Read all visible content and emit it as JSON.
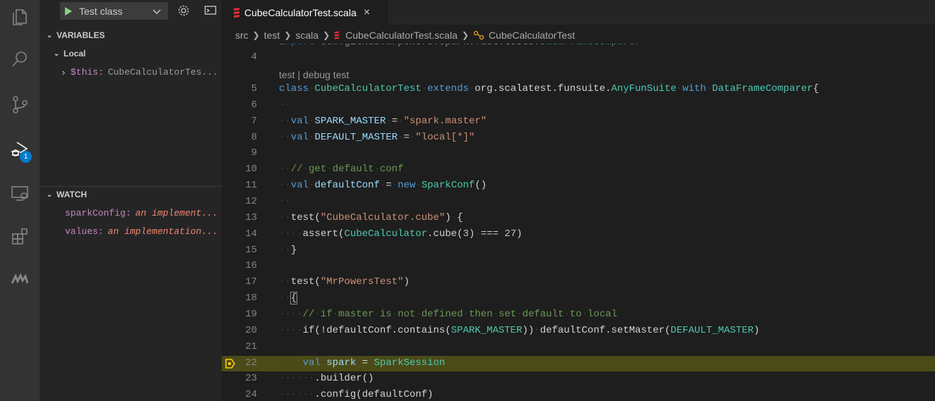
{
  "debug": {
    "config_label": "Test class"
  },
  "variables": {
    "header": "VARIABLES",
    "scope_label": "Local",
    "items": [
      {
        "name": "$this:",
        "value": "CubeCalculatorTes..."
      }
    ]
  },
  "watch": {
    "header": "WATCH",
    "items": [
      {
        "name": "sparkConfig:",
        "value": "an implement..."
      },
      {
        "name": "values:",
        "value": "an implementation..."
      }
    ]
  },
  "activity": {
    "debug_badge": "1"
  },
  "tab": {
    "filename": "CubeCalculatorTest.scala",
    "close": "×"
  },
  "breadcrumbs": [
    "src",
    "test",
    "scala",
    "CubeCalculatorTest.scala",
    "CubeCalculatorTest"
  ],
  "code": {
    "codelens": "test | debug test",
    "partial_top_line": "import com.github.mrpowers.spark.fast.tests.DataFrameComparer",
    "line_numbers": [
      "4",
      "5",
      "6",
      "7",
      "8",
      "9",
      "10",
      "11",
      "12",
      "13",
      "14",
      "15",
      "16",
      "17",
      "18",
      "19",
      "20",
      "21",
      "22",
      "23",
      "24"
    ],
    "current_line": "22"
  },
  "colors": {
    "current_line_bg": "#4b4b18",
    "accent": "#007acc"
  }
}
